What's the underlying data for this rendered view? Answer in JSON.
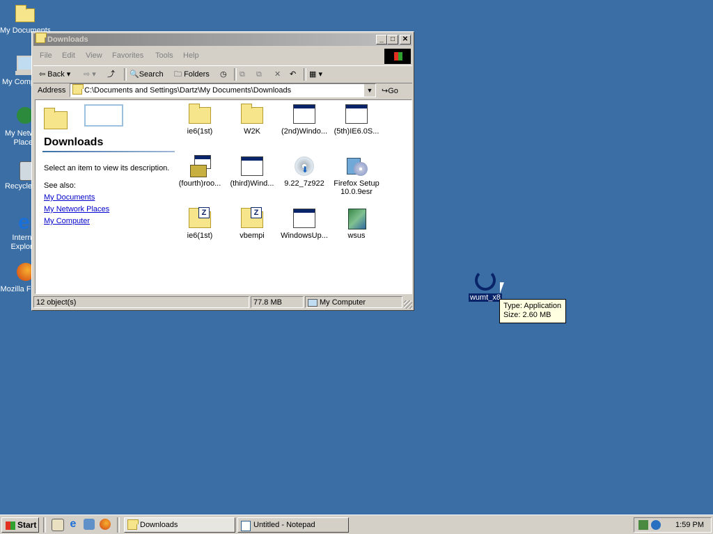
{
  "desktop": {
    "icons": [
      {
        "label": "My Documents"
      },
      {
        "label": "My Computer"
      },
      {
        "label": "My Network Places"
      },
      {
        "label": "Recycle Bin"
      },
      {
        "label": "Internet Explorer"
      },
      {
        "label": "Mozilla Firefox"
      }
    ],
    "selected_icon": {
      "label": "wumt_x8"
    },
    "tooltip": {
      "type": "Type: Application",
      "size": "Size: 2.60 MB"
    }
  },
  "window": {
    "title": "Downloads",
    "menu": [
      "File",
      "Edit",
      "View",
      "Favorites",
      "Tools",
      "Help"
    ],
    "toolbar": {
      "back": "Back",
      "search": "Search",
      "folders": "Folders"
    },
    "address": {
      "label": "Address",
      "value": "C:\\Documents and Settings\\Dartz\\My Documents\\Downloads",
      "go": "Go"
    },
    "left_pane": {
      "title": "Downloads",
      "description": "Select an item to view its description.",
      "see_also": "See also:",
      "links": [
        "My Documents",
        "My Network Places",
        "My Computer"
      ]
    },
    "files": [
      {
        "label": "ie6(1st)",
        "icon": "folder-icon"
      },
      {
        "label": "W2K",
        "icon": "folder-icon"
      },
      {
        "label": "(2nd)Windo...",
        "icon": "application-icon"
      },
      {
        "label": "(5th)IE6.0S...",
        "icon": "application-icon"
      },
      {
        "label": "(fourth)roo...",
        "icon": "installer-icon"
      },
      {
        "label": "(third)Wind...",
        "icon": "application-icon"
      },
      {
        "label": "9.22_7z922",
        "icon": "cd-installer-icon"
      },
      {
        "label": "Firefox Setup 10.0.9esr",
        "icon": "setup-icon"
      },
      {
        "label": "ie6(1st)",
        "icon": "zipped-folder-icon"
      },
      {
        "label": "vbempi",
        "icon": "zipped-folder-icon"
      },
      {
        "label": "WindowsUp...",
        "icon": "application-icon"
      },
      {
        "label": "wsus",
        "icon": "package-icon"
      }
    ],
    "status": {
      "objects": "12 object(s)",
      "size": "77.8 MB",
      "location": "My Computer"
    }
  },
  "taskbar": {
    "start": "Start",
    "tasks": [
      "Downloads",
      "Untitled - Notepad"
    ],
    "clock": "1:59 PM"
  }
}
